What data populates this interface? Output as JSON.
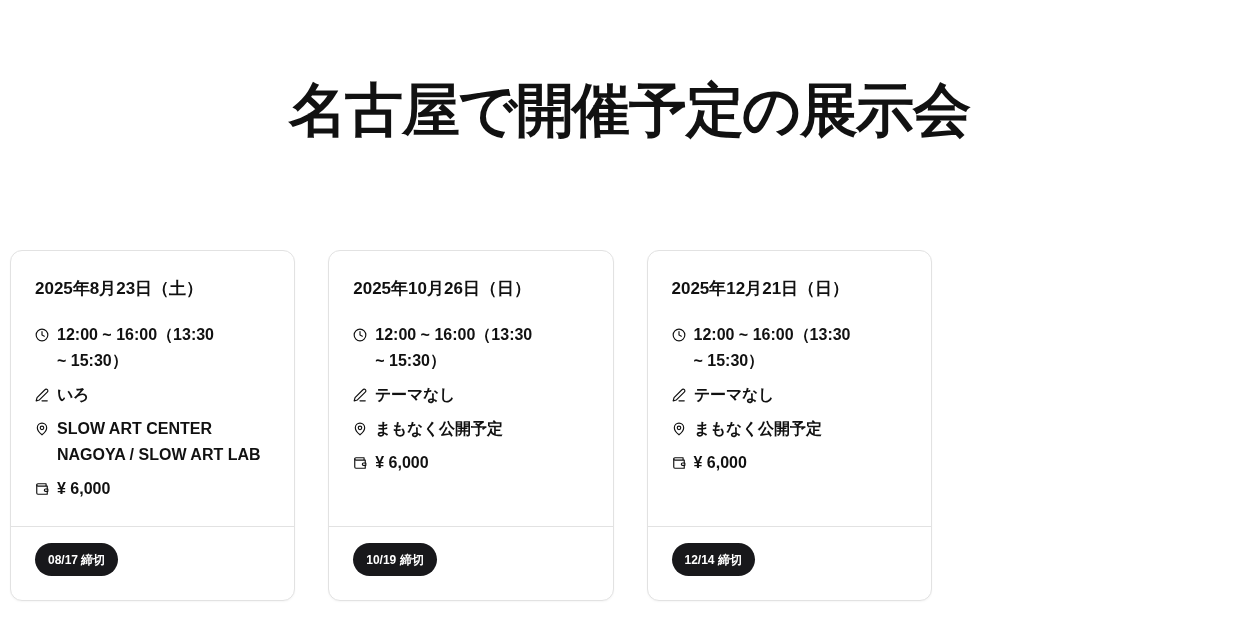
{
  "title": "名古屋で開催予定の展示会",
  "events": [
    {
      "date": "2025年8月23日（土）",
      "details": [
        {
          "kind": "time",
          "text": "12:00 ~ 16:00（13:30 ~ 15:30）"
        },
        {
          "kind": "theme",
          "text": "いろ"
        },
        {
          "kind": "venue",
          "text": "SLOW ART CENTER NAGOYA / SLOW ART LAB"
        },
        {
          "kind": "price",
          "text": "¥ 6,000"
        }
      ],
      "deadline": "08/17 締切"
    },
    {
      "date": "2025年10月26日（日）",
      "details": [
        {
          "kind": "time",
          "text": "12:00 ~ 16:00（13:30 ~ 15:30）"
        },
        {
          "kind": "theme",
          "text": "テーマなし"
        },
        {
          "kind": "venue",
          "text": "まもなく公開予定"
        },
        {
          "kind": "price",
          "text": "¥ 6,000"
        }
      ],
      "deadline": "10/19 締切"
    },
    {
      "date": "2025年12月21日（日）",
      "details": [
        {
          "kind": "time",
          "text": "12:00 ~ 16:00（13:30 ~ 15:30）"
        },
        {
          "kind": "theme",
          "text": "テーマなし"
        },
        {
          "kind": "venue",
          "text": "まもなく公開予定"
        },
        {
          "kind": "price",
          "text": "¥ 6,000"
        }
      ],
      "deadline": "12/14 締切"
    }
  ]
}
